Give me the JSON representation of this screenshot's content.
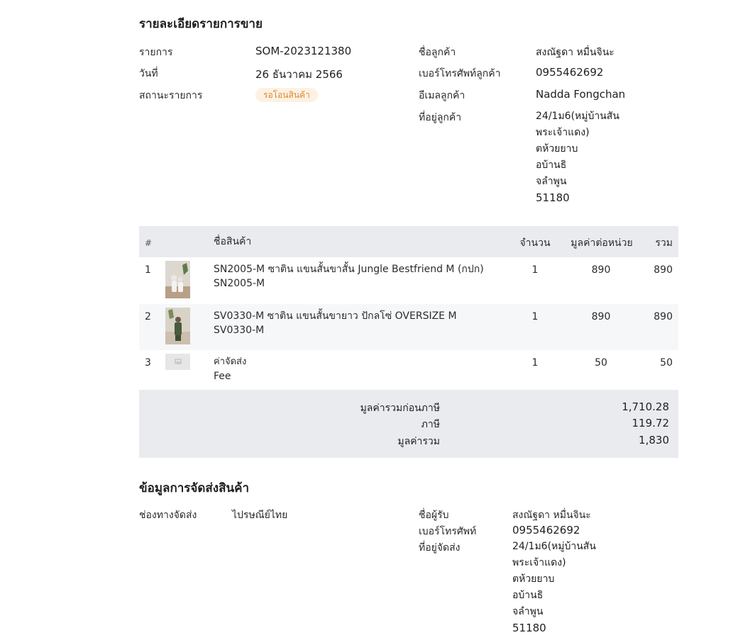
{
  "order": {
    "title": "รายละเอียดรายการขาย",
    "fields": {
      "order_label": "รายการ",
      "order_value": "SOM-2023121380",
      "date_label": "วันที่",
      "date_value": "26 ธันวาคม 2566",
      "status_label": "สถานะรายการ",
      "status_value": "รอโอนสินค้า"
    },
    "customer": {
      "name_label": "ชื่อลูกค้า",
      "name_value": "สงณัฐดา หมื่นจินะ",
      "phone_label": "เบอร์โทรศัพท์ลูกค้า",
      "phone_value": "0955462692",
      "email_label": "อีเมลลูกค้า",
      "email_value": "Nadda Fongchan",
      "address_label": "ที่อยู่ลูกค้า",
      "address_lines": [
        "24/1ม6(หมู่บ้านสัน",
        "พระเจ้าแดง)",
        "ตห้วยยาบ",
        "อบ้านธิ",
        "จลำพูน",
        "51180"
      ]
    }
  },
  "table": {
    "headers": {
      "num": "#",
      "name": "ชื่อสินค้า",
      "qty": "จำนวน",
      "unit_price": "มูลค่าต่อหน่วย",
      "total": "รวม"
    },
    "rows": [
      {
        "num": "1",
        "name": "SN2005-M ซาติน แขนสั้นขาสั้น Jungle Bestfriend M (กปก)",
        "sku": "SN2005-M",
        "qty": "1",
        "unit_price": "890",
        "total": "890"
      },
      {
        "num": "2",
        "name": "SV0330-M ซาติน แขนสั้นขายาว ปักลโซ่ OVERSIZE M",
        "sku": "SV0330-M",
        "qty": "1",
        "unit_price": "890",
        "total": "890"
      },
      {
        "num": "3",
        "name": "ค่าจัดส่ง",
        "sku": "Fee",
        "qty": "1",
        "unit_price": "50",
        "total": "50"
      }
    ],
    "totals": {
      "subtotal_label": "มูลค่ารวมก่อนภาษี",
      "subtotal_value": "1,710.28",
      "tax_label": "ภาษี",
      "tax_value": "119.72",
      "grand_label": "มูลค่ารวม",
      "grand_value": "1,830"
    }
  },
  "shipping": {
    "title": "ข้อมูลการจัดส่งสินค้า",
    "channel_label": "ช่องทางจัดส่ง",
    "channel_value": "ไปรษณีย์ไทย",
    "recipient_label": "ชื่อผู้รับ",
    "recipient_value": "สงณัฐดา หมื่นจินะ",
    "phone_label": "เบอร์โทรศัพท์",
    "phone_value": "0955462692",
    "address_label": "ที่อยู่จัดส่ง",
    "address_lines": [
      "24/1ม6(หมู่บ้านสัน",
      "พระเจ้าแดง)",
      "ตห้วยยาบ",
      "อบ้านธิ",
      "จลำพูน",
      "51180"
    ]
  },
  "colors": {
    "header_bg": "#e9ebee",
    "alt_row_bg": "#f6f7f8",
    "badge_bg": "#fdf1e2",
    "badge_text": "#d98a35"
  }
}
